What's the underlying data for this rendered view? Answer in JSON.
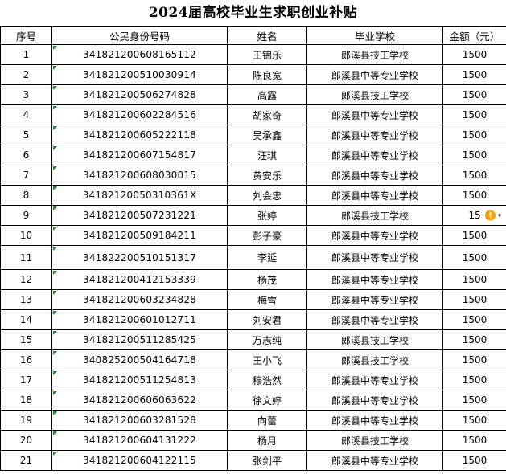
{
  "title": "2024届高校毕业生求职创业补贴",
  "headers": {
    "seq": "序号",
    "id": "公民身份号码",
    "name": "姓名",
    "school": "毕业学校",
    "amount": "金额（元）"
  },
  "rows": [
    {
      "seq": "1",
      "id": "341821200608165112",
      "name": "王锦乐",
      "school": "郎溪县技工学校",
      "amount": "1500"
    },
    {
      "seq": "2",
      "id": "341821200510030914",
      "name": "陈良宽",
      "school": "郎溪县中等专业学校",
      "amount": "1500"
    },
    {
      "seq": "3",
      "id": "341821200506274828",
      "name": "高露",
      "school": "郎溪县技工学校",
      "amount": "1500"
    },
    {
      "seq": "4",
      "id": "341821200602284516",
      "name": "胡家奇",
      "school": "郎溪县中等专业学校",
      "amount": "1500"
    },
    {
      "seq": "5",
      "id": "341821200605222118",
      "name": "吴承鑫",
      "school": "郎溪县中等专业学校",
      "amount": "1500"
    },
    {
      "seq": "6",
      "id": "341821200607154817",
      "name": "汪琪",
      "school": "郎溪县中等专业学校",
      "amount": "1500"
    },
    {
      "seq": "7",
      "id": "341821200608030015",
      "name": "黄安乐",
      "school": "郎溪县中等专业学校",
      "amount": "1500"
    },
    {
      "seq": "8",
      "id": "34182120050310361X",
      "name": "刘会忠",
      "school": "郎溪县中等专业学校",
      "amount": "1500"
    },
    {
      "seq": "9",
      "id": "341821200507231221",
      "name": "张婷",
      "school": "郎溪县技工学校",
      "amount": "15"
    },
    {
      "seq": "10",
      "id": "341821200509184211",
      "name": "彭子豪",
      "school": "郎溪县中等专业学校",
      "amount": "1500"
    },
    {
      "seq": "11",
      "id": "341822200510151317",
      "name": "李延",
      "school": "郎溪县中等专业学校",
      "amount": "1500"
    },
    {
      "seq": "12",
      "id": "341821200412153339",
      "name": "杨茂",
      "school": "郎溪县中等专业学校",
      "amount": "1500"
    },
    {
      "seq": "13",
      "id": "341821200603234828",
      "name": "梅雪",
      "school": "郎溪县中等专业学校",
      "amount": "1500"
    },
    {
      "seq": "14",
      "id": "341821200601012711",
      "name": "刘安君",
      "school": "郎溪县中等专业学校",
      "amount": "1500"
    },
    {
      "seq": "15",
      "id": "341821200511285425",
      "name": "万志纯",
      "school": "郎溪县技工学校",
      "amount": "1500"
    },
    {
      "seq": "16",
      "id": "340825200504164718",
      "name": "王小飞",
      "school": "郎溪县技工学校",
      "amount": "1500"
    },
    {
      "seq": "17",
      "id": "341821200511254813",
      "name": "穆浩然",
      "school": "郎溪县中等专业学校",
      "amount": "1500"
    },
    {
      "seq": "18",
      "id": "341821200606063622",
      "name": "徐文婷",
      "school": "郎溪县中等专业学校",
      "amount": "1500"
    },
    {
      "seq": "19",
      "id": "341821200603281528",
      "name": "向蕾",
      "school": "郎溪县中等专业学校",
      "amount": "1500"
    },
    {
      "seq": "20",
      "id": "341821200604131222",
      "name": "杨月",
      "school": "郎溪县技工学校",
      "amount": "1500"
    },
    {
      "seq": "21",
      "id": "341821200604122115",
      "name": "张剑平",
      "school": "郎溪县中等专业学校",
      "amount": "1500"
    }
  ],
  "warning": {
    "row_index": 8,
    "icon": "warning-icon",
    "glyph": "!",
    "chevron": "▾",
    "color": "#f0a30a"
  },
  "colors": {
    "marker": "#1f8a3a"
  }
}
